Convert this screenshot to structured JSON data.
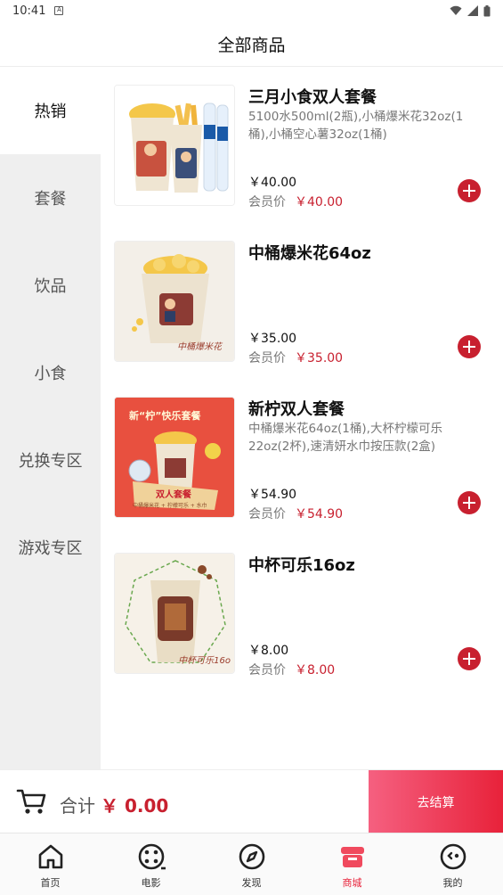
{
  "status_bar": {
    "time": "10:41",
    "sim_label": "A"
  },
  "header": {
    "title": "全部商品"
  },
  "sidebar": {
    "items": [
      {
        "label": "热销",
        "active": true
      },
      {
        "label": "套餐"
      },
      {
        "label": "饮品"
      },
      {
        "label": "小食"
      },
      {
        "label": "兑换专区"
      },
      {
        "label": "游戏专区"
      }
    ]
  },
  "products": [
    {
      "name": "三月小食双人套餐",
      "desc": "5100水500ml(2瓶),小桶爆米花32oz(1桶),小桶空心薯32oz(1桶)",
      "price": "￥40.00",
      "member_label": "会员价",
      "member_price": "￥40.00"
    },
    {
      "name": "中桶爆米花64oz",
      "desc": "",
      "price": "￥35.00",
      "member_label": "会员价",
      "member_price": "￥35.00",
      "image_caption": "中桶爆米花"
    },
    {
      "name": "新柠双人套餐",
      "desc": "中桶爆米花64oz(1桶),大杯柠檬可乐22oz(2杯),速清妍水巾按压款(2盒)",
      "price": "￥54.90",
      "member_label": "会员价",
      "member_price": "￥54.90",
      "image_banner": "新“柠”快乐套餐",
      "image_tag": "双人套餐",
      "image_sub": "中桶爆米花 + 柠檬可乐 + 水巾"
    },
    {
      "name": "中杯可乐16oz",
      "desc": "",
      "price": "￥8.00",
      "member_label": "会员价",
      "member_price": "￥8.00",
      "image_caption": "中杯可乐16o"
    }
  ],
  "cart": {
    "total_label": "合计",
    "total_value": "￥ 0.00",
    "checkout_label": "去结算"
  },
  "tabs": [
    {
      "label": "首页",
      "icon": "home-icon"
    },
    {
      "label": "电影",
      "icon": "film-reel-icon"
    },
    {
      "label": "发现",
      "icon": "compass-icon"
    },
    {
      "label": "商城",
      "icon": "store-icon",
      "active": true
    },
    {
      "label": "我的",
      "icon": "profile-face-icon"
    }
  ],
  "colors": {
    "accent": "#c8202f",
    "checkout_gradient_start": "#f56080",
    "checkout_gradient_end": "#e8223a"
  }
}
